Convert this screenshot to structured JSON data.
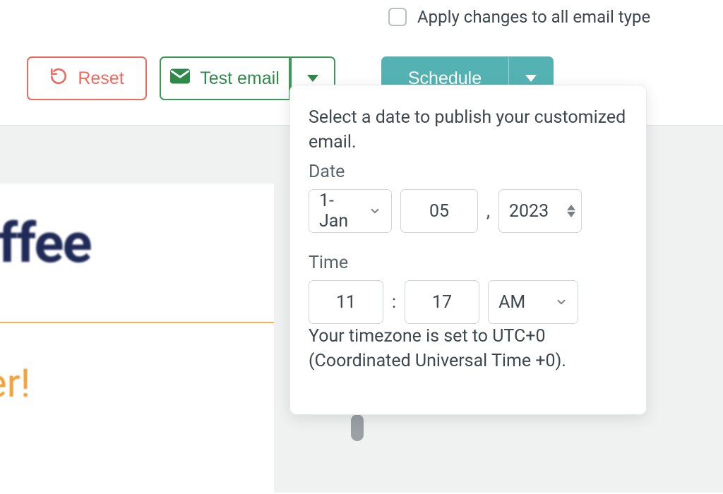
{
  "toolbar": {
    "apply_all_label": "Apply changes to all email type",
    "apply_all_checked": false,
    "reset_label": "Reset",
    "test_email_label": "Test email",
    "schedule_label": "Schedule"
  },
  "popover": {
    "intro": "Select a date to publish your customized email.",
    "date_label": "Date",
    "time_label": "Time",
    "month_value": "1-Jan",
    "day_value": "05",
    "year_value": "2023",
    "hour_value": "11",
    "minute_value": "17",
    "ampm_value": "AM",
    "comma": ",",
    "colon": ":",
    "timezone_line": "Your timezone is set to UTC+0 (Coordinated Universal Time +0)."
  },
  "preview": {
    "logo_fragment": "otoffee",
    "headline_fragment": "rder!"
  }
}
